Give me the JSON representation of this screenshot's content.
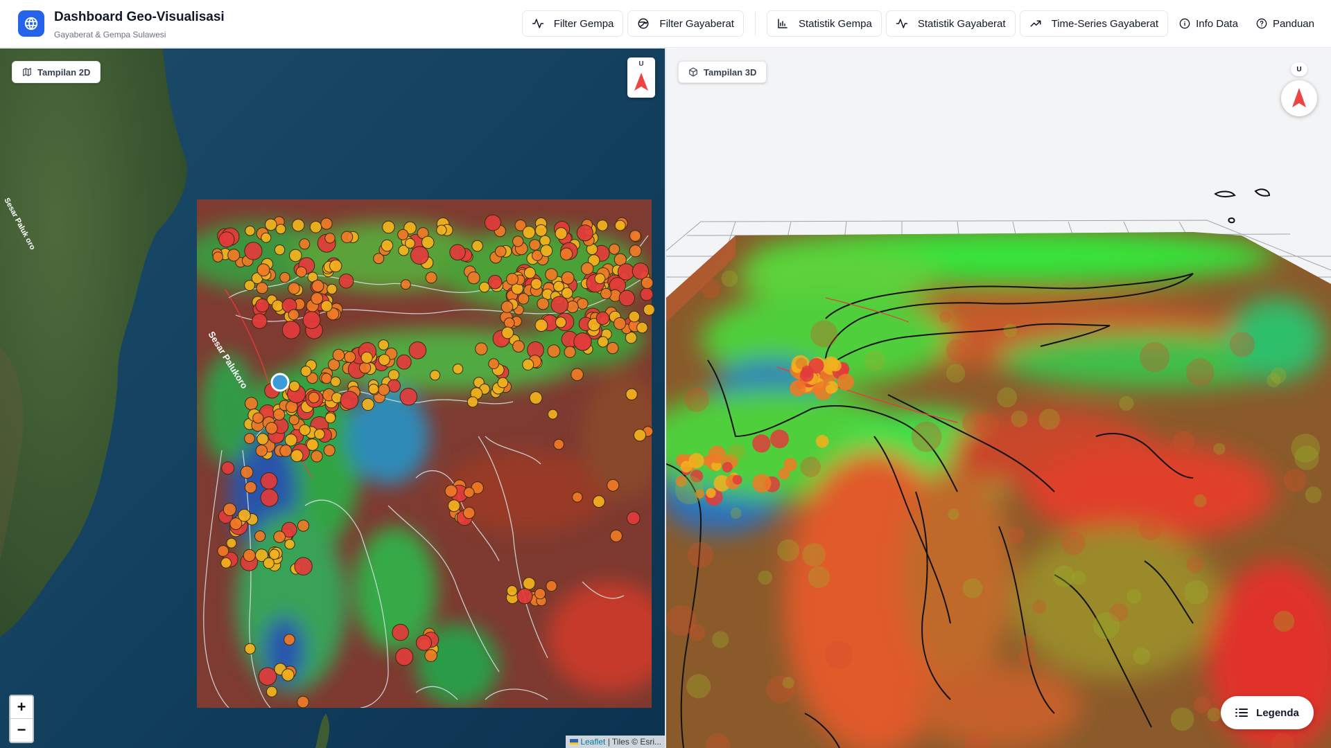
{
  "header": {
    "title": "Dashboard Geo-Visualisasi",
    "subtitle": "Gayaberat & Gempa Sulawesi"
  },
  "nav": {
    "filter_gempa": "Filter Gempa",
    "filter_gayaberat": "Filter Gayaberat",
    "statistik_gempa": "Statistik Gempa",
    "statistik_gayaberat": "Statistik Gayaberat",
    "time_series": "Time-Series Gayaberat",
    "info_data": "Info Data",
    "panduan": "Panduan"
  },
  "map2d": {
    "view_label": "Tampilan 2D",
    "compass_label": "U",
    "fault_label": "Sesar Palukoro",
    "fault_label_top": "Sesar Paluk oro",
    "zoom_in": "+",
    "zoom_out": "−",
    "attribution_link": "Leaflet",
    "attribution_text": "| Tiles © Esri..."
  },
  "map3d": {
    "view_label": "Tampilan 3D",
    "compass_label": "U",
    "legend_label": "Legenda"
  },
  "colors": {
    "accent": "#2563eb",
    "quake_red": "#e23b3b",
    "quake_orange": "#f07a26",
    "quake_yellow": "#f3b21d",
    "selected_marker": "#3b9ad9",
    "gravity_high": "#c0392b",
    "gravity_mid": "#22c55e",
    "gravity_low": "#1e40af"
  }
}
